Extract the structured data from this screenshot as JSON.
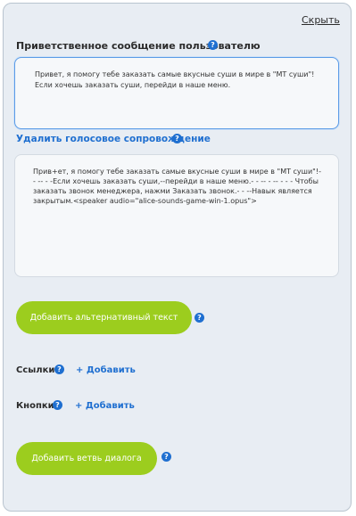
{
  "header": {
    "hide_label": "Скрыть"
  },
  "greeting": {
    "label": "Приветственное сообщение пользователю",
    "text": "Привет, я помогу тебе заказать самые вкусные суши в мире в \"МТ суши\"! Если хочешь заказать суши, перейди в наше меню."
  },
  "voice": {
    "remove_label": "Удалить голосовое сопровождение",
    "tts_text": "Прив+ет, я помогу тебе заказать самые вкусные суши в мире в \"МТ суши\"!- - -- - -Если хочешь заказать суши,--перейди в наше меню.- - -- - -- - - - Чтобы заказать звонок менеджера, нажми Заказать звонок.- - --Навык является закрытым.<speaker audio=\"alice-sounds-game-win-1.opus\">"
  },
  "alt_text_button": {
    "label": "Добавить альтернативный текст"
  },
  "links": {
    "label": "Ссылки",
    "add_label": "+ Добавить"
  },
  "buttons": {
    "label": "Кнопки",
    "add_label": "+ Добавить"
  },
  "branch_button": {
    "label": "Добавить ветвь диалога"
  },
  "help_glyph": "?",
  "colors": {
    "accent_green": "#9ccd1e",
    "link_blue": "#1f6fd0",
    "panel_bg": "#e8edf3"
  }
}
